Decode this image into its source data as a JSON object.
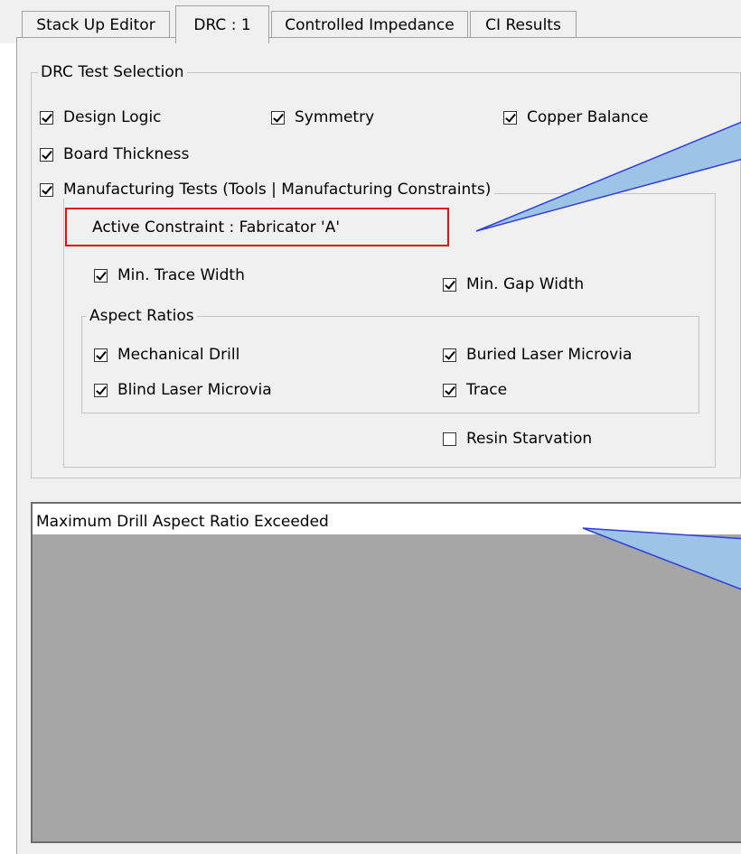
{
  "tabs": [
    {
      "label": "Stack Up Editor"
    },
    {
      "label": "DRC : 1"
    },
    {
      "label": "Controlled Impedance"
    },
    {
      "label": "CI Results"
    }
  ],
  "drc_group": {
    "title": "DRC Test Selection",
    "design_logic": {
      "label": "Design Logic",
      "checked": true
    },
    "symmetry": {
      "label": "Symmetry",
      "checked": true
    },
    "copper_balance": {
      "label": "Copper Balance",
      "checked": true
    },
    "board_thickness": {
      "label": "Board Thickness",
      "checked": true
    },
    "manufacturing_tests": {
      "label": "Manufacturing Tests (Tools | Manufacturing Constraints)",
      "checked": true
    }
  },
  "manufacturing": {
    "active_constraint": "Active Constraint : Fabricator 'A'",
    "min_trace_width": {
      "label": "Min. Trace Width",
      "checked": true
    },
    "min_gap_width": {
      "label": "Min. Gap Width",
      "checked": true
    },
    "resin_starvation": {
      "label": "Resin Starvation",
      "checked": false
    }
  },
  "aspect_ratios": {
    "title": "Aspect Ratios",
    "mechanical_drill": {
      "label": "Mechanical Drill",
      "checked": true
    },
    "buried_laser_microvia": {
      "label": "Buried Laser Microvia",
      "checked": true
    },
    "blind_laser_microvia": {
      "label": "Blind Laser Microvia",
      "checked": true
    },
    "trace": {
      "label": "Trace",
      "checked": true
    }
  },
  "results": {
    "items": [
      "Maximum Drill Aspect Ratio Exceeded"
    ]
  },
  "colors": {
    "highlight_border": "#e01010",
    "callout_fill": "#9dc3e6",
    "callout_stroke": "#2f3fd8"
  }
}
